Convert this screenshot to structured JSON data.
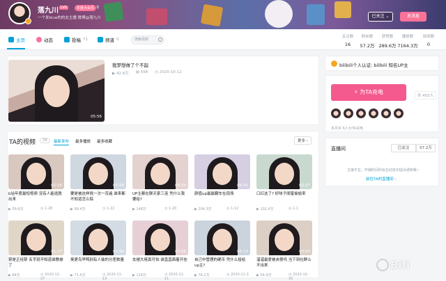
{
  "header": {
    "username": "落九川",
    "level": "LV6",
    "vip": "年度大会员",
    "sex_icon": "girl-icon",
    "signature": "一个发blue的的女主播 微博@落九川",
    "follow_label": "已关注 ⌄",
    "message_label": "发消息"
  },
  "nav": {
    "items": [
      {
        "label": "主页",
        "count": "",
        "icon": "home-icon",
        "color": "#00a1d6"
      },
      {
        "label": "动态",
        "count": "",
        "icon": "dynamic-icon",
        "color": "#fb7299"
      },
      {
        "label": "投稿",
        "count": "71",
        "icon": "upload-icon",
        "color": "#00a1d6"
      },
      {
        "label": "频道",
        "count": "0",
        "icon": "channel-icon",
        "color": "#00a1d6"
      }
    ],
    "search_placeholder": "搜索视频"
  },
  "stats": [
    {
      "label": "关注数",
      "value": "16"
    },
    {
      "label": "粉丝数",
      "value": "57.2万"
    },
    {
      "label": "获赞数",
      "value": "289.6万"
    },
    {
      "label": "播放数",
      "value": "7164.3万"
    },
    {
      "label": "阅读数",
      "value": "0"
    }
  ],
  "masterpiece": {
    "title": "我梦想做了个不起",
    "duration": "05:56",
    "views": "42.8万",
    "danmaku": "598",
    "date": "2020-10-12"
  },
  "videos": {
    "title": "TA的视频",
    "count": "36",
    "sorts": [
      "最新发布",
      "最多播放",
      "最多收藏"
    ],
    "more": "更多 ›",
    "items": [
      {
        "title": "b站年度最短视频 没有人能逃脱出来",
        "dur": "02:18",
        "views": "59.6万",
        "date": "1-28"
      },
      {
        "title": "要是被这样挑一次一百遍 谁来都不知道怎么惦",
        "dur": "07:49",
        "views": "99.4万",
        "date": "1-22"
      },
      {
        "title": "UP主都在聊天家三连 凭什么我要给?",
        "dur": "09:33",
        "views": "148万",
        "date": "1-20"
      },
      {
        "title": "颜值up最最翻车在现场",
        "dur": "04:41",
        "views": "204.3万",
        "date": "1-12"
      },
      {
        "title": "口红这了? 好味子闺蜜偷偷来",
        "dur": "02:27",
        "views": "102.4万",
        "date": "1-1"
      },
      {
        "title": "禁是正经禁 名字就不知道谁教悬了",
        "dur": "01:17",
        "views": "84万",
        "date": "2020-12-27"
      },
      {
        "title": "奥更鸟早鸭别有人偷的分差数量",
        "dur": "07:44",
        "views": "71.6万",
        "date": "2020-11-13"
      },
      {
        "title": "女裙大佬真可怕 谁直直面着开挂",
        "dur": "02:55",
        "views": "124万",
        "date": "2020-11-11"
      },
      {
        "title": "自己中管理的硬币 凭什么投给up主?",
        "dur": "06:13",
        "views": "76.2万",
        "date": "2020-11-3"
      },
      {
        "title": "溜溜最爱被夹傻吗 当下到社群么不出来",
        "dur": "03:03",
        "views": "56.9万",
        "date": "2020-10-30"
      }
    ]
  },
  "auth": {
    "text": "bilibili个人认证: bilibili 知名UP主"
  },
  "charge": {
    "button": "为TA充电",
    "count": "共 455人",
    "note": "本月共 6人为TA充电"
  },
  "live": {
    "title": "直播间",
    "follow": "已关注",
    "fans": "57.2万",
    "offline": "主播不在，开播时间你会在动态中提出通知哦~",
    "link": "前往TA的直播间 ›"
  },
  "watermark": "Bili"
}
